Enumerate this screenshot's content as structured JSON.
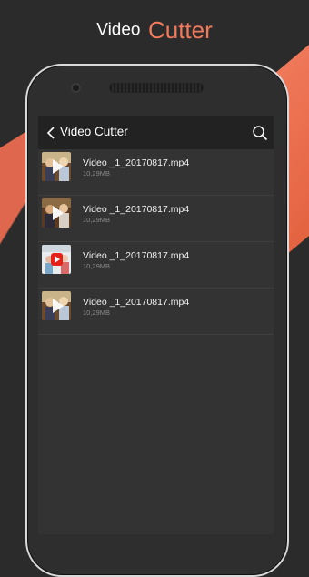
{
  "promo": {
    "word1": "Video",
    "word2": "Cutter",
    "accent_color": "#f07a5c"
  },
  "toolbar": {
    "back_icon": "chevron-left-icon",
    "title": "Video Cutter",
    "search_icon": "search-icon"
  },
  "files": [
    {
      "name": "Video _1_20170817.mp4",
      "size": "10,29MB",
      "thumb": "video-thumbnail-people"
    },
    {
      "name": "Video _1_20170817.mp4",
      "size": "10,29MB",
      "thumb": "video-thumbnail-people"
    },
    {
      "name": "Video _1_20170817.mp4",
      "size": "10,29MB",
      "thumb": "video-thumbnail-youtube"
    },
    {
      "name": "Video _1_20170817.mp4",
      "size": "10,29MB",
      "thumb": "video-thumbnail-people"
    }
  ]
}
